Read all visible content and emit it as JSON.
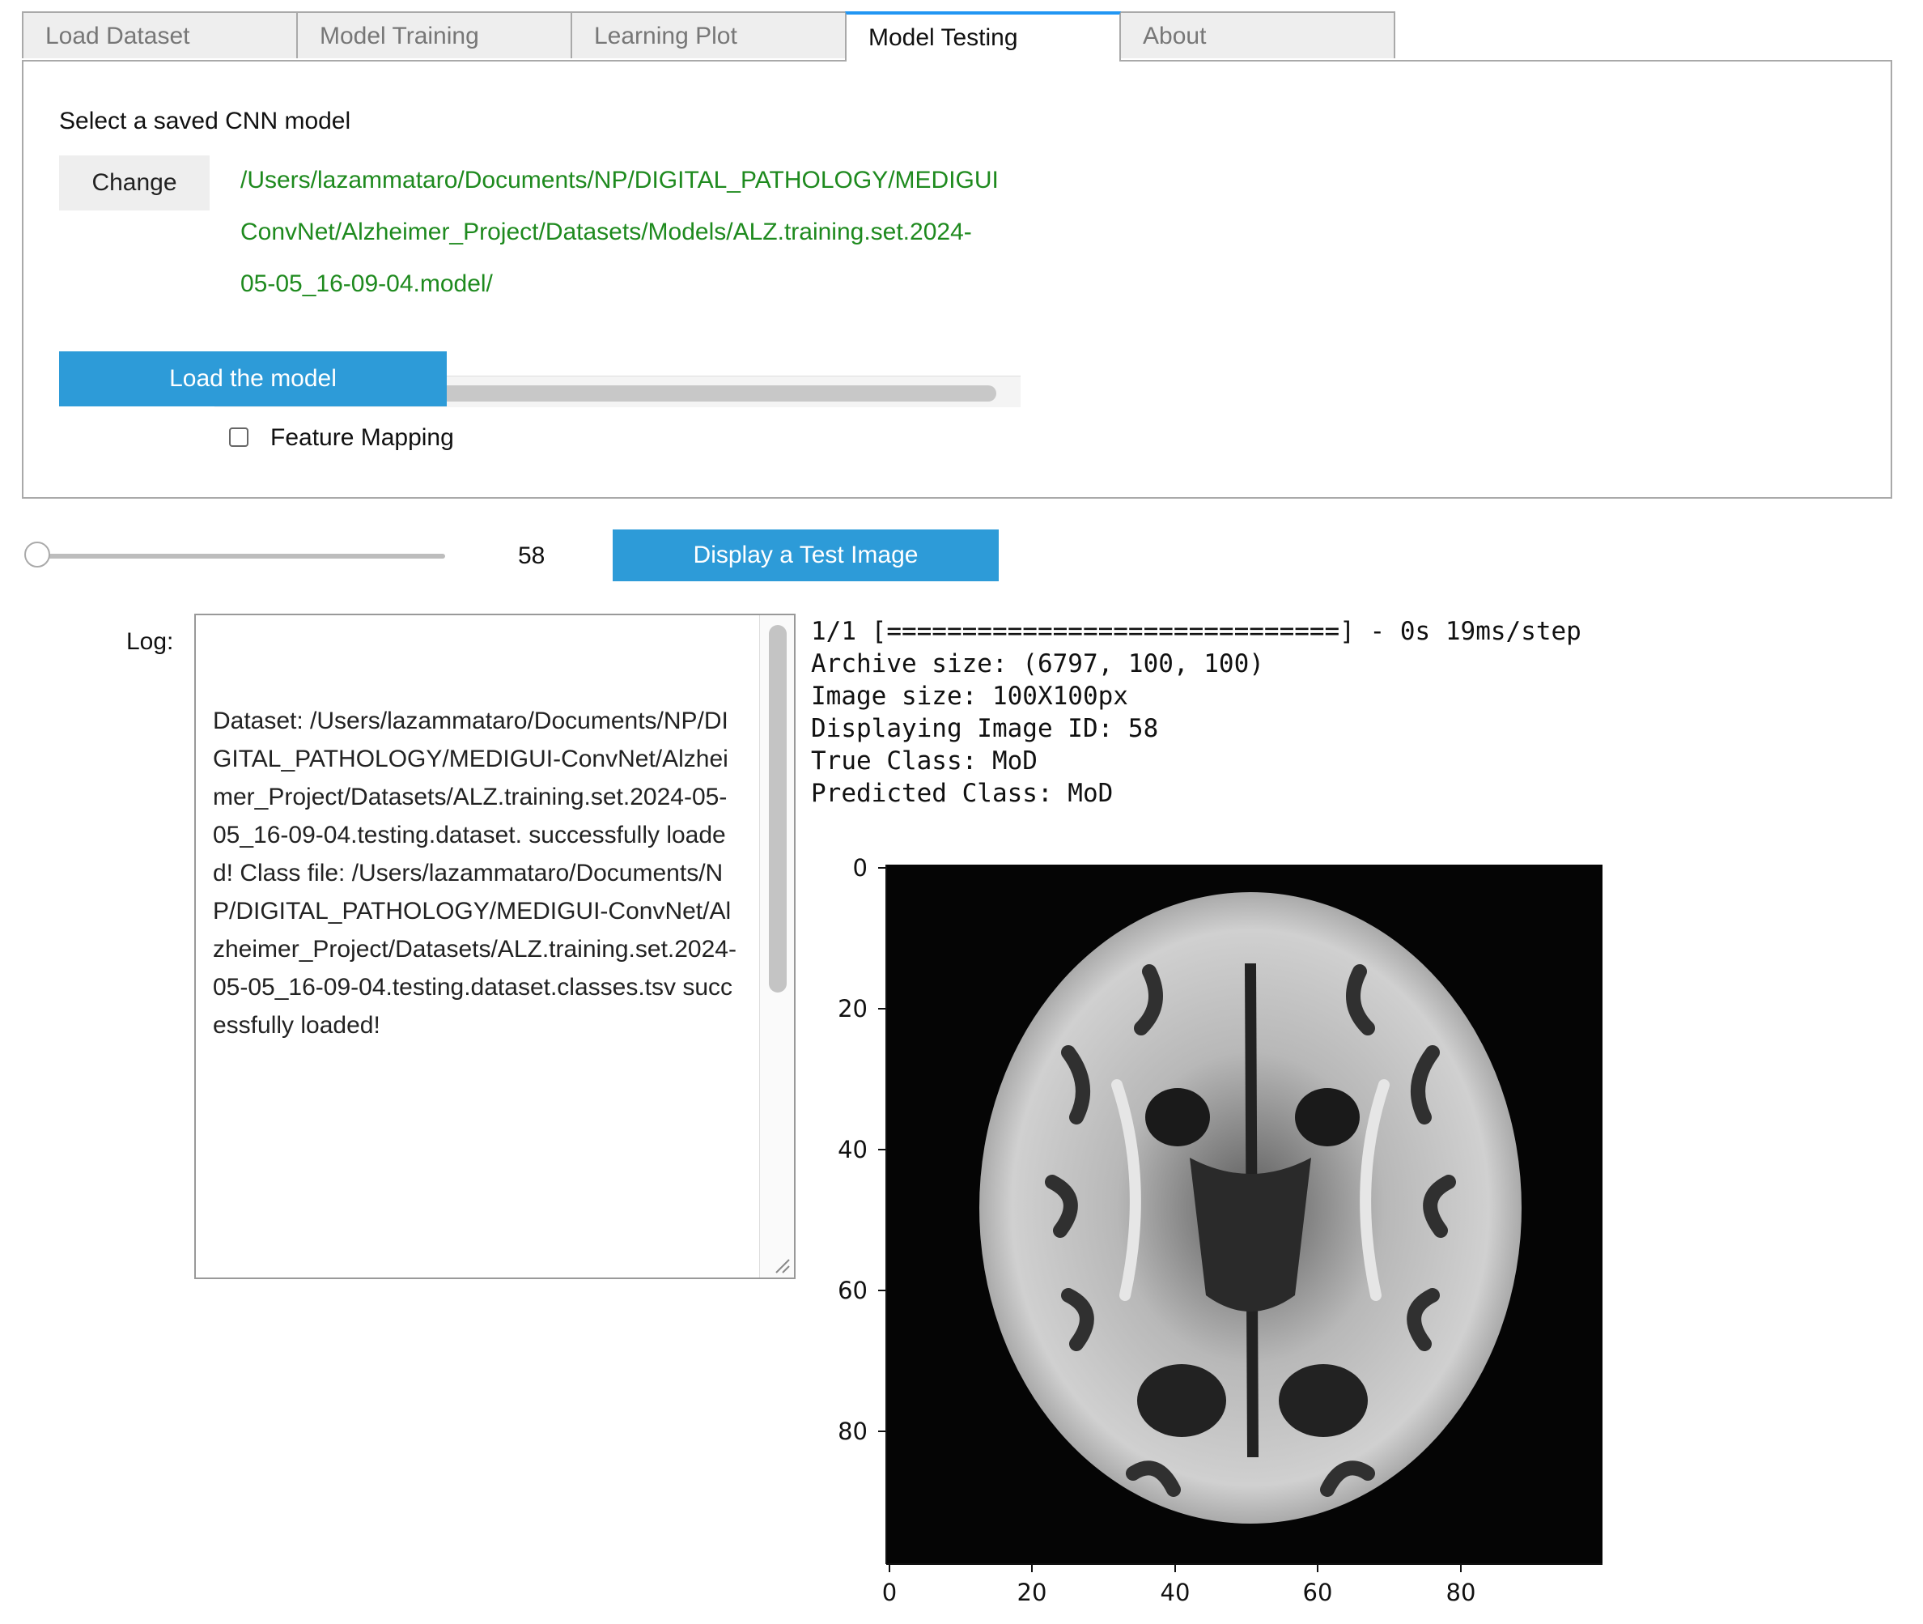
{
  "tabs": [
    "Load Dataset",
    "Model Training",
    "Learning Plot",
    "Model Testing",
    "About"
  ],
  "active_tab": "Model Testing",
  "panel": {
    "select_label": "Select a saved CNN model",
    "change_label": "Change",
    "path_lines": [
      "/Users/lazammataro/Documents/NP/DIGITAL_PATHOLOGY/MEDIGUI",
      "ConvNet/Alzheimer_Project/Datasets/Models/ALZ.training.set.2024-",
      "05-05_16-09-04.model/"
    ],
    "load_button": "Load the model",
    "feature_mapping_label": "Feature Mapping",
    "feature_mapping_checked": false
  },
  "controls": {
    "slider_value": "58",
    "display_button": "Display a Test Image"
  },
  "log": {
    "label": "Log:",
    "text": "Dataset: /Users/lazammataro/Documents/NP/DIGITAL_PATHOLOGY/MEDIGUI-ConvNet/Alzheimer_Project/Datasets/ALZ.training.set.2024-05-05_16-09-04.testing.dataset. successfully loaded! Class file: /Users/lazammataro/Documents/NP/DIGITAL_PATHOLOGY/MEDIGUI-ConvNet/Alzheimer_Project/Datasets/ALZ.training.set.2024-05-05_16-09-04.testing.dataset.classes.tsv successfully loaded!"
  },
  "output": {
    "lines": [
      "1/1 [==============================] - 0s 19ms/step",
      "Archive size: (6797, 100, 100)",
      "Image size: 100X100px",
      "Displaying Image ID: 58",
      "True Class: MoD",
      "Predicted Class: MoD"
    ]
  },
  "plot": {
    "x_ticks": [
      "0",
      "20",
      "40",
      "60",
      "80"
    ],
    "y_ticks": [
      "0",
      "20",
      "40",
      "60",
      "80"
    ],
    "image_description_icon": "brain-mri-slice"
  }
}
